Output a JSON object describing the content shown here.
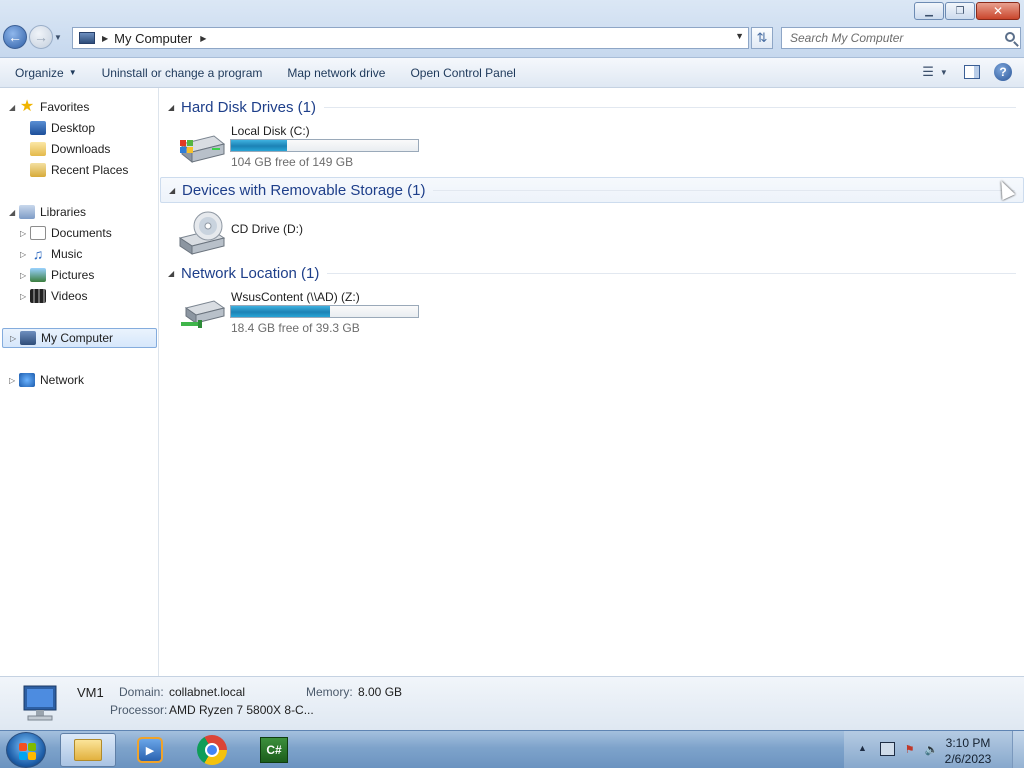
{
  "window": {
    "controls": {
      "minimize": "▁",
      "maximize": "❐",
      "close": "✕"
    }
  },
  "address": {
    "path": "My Computer",
    "search_placeholder": "Search My Computer"
  },
  "toolbar": {
    "organize": "Organize",
    "uninstall": "Uninstall or change a program",
    "map_drive": "Map network drive",
    "control_panel": "Open Control Panel"
  },
  "nav": {
    "favorites": "Favorites",
    "desktop": "Desktop",
    "downloads": "Downloads",
    "recent": "Recent Places",
    "libraries": "Libraries",
    "documents": "Documents",
    "music": "Music",
    "pictures": "Pictures",
    "videos": "Videos",
    "computer": "My Computer",
    "network": "Network"
  },
  "groups": {
    "hdd": "Hard Disk Drives (1)",
    "removable": "Devices with Removable Storage (1)",
    "network": "Network Location (1)"
  },
  "drives": {
    "c": {
      "name": "Local Disk (C:)",
      "free": "104 GB free of 149 GB",
      "used_fraction": 0.3
    },
    "d": {
      "name": "CD Drive (D:)"
    },
    "z": {
      "name": "WsusContent (\\\\AD) (Z:)",
      "free": "18.4 GB free of 39.3 GB",
      "used_fraction": 0.53
    }
  },
  "details": {
    "name": "VM1",
    "domain_label": "Domain:",
    "domain": "collabnet.local",
    "memory_label": "Memory:",
    "memory": "8.00 GB",
    "processor_label": "Processor:",
    "processor": "AMD Ryzen 7 5800X 8-C..."
  },
  "taskbar": {
    "csharp_label": "C#",
    "time": "3:10 PM",
    "date": "2/6/2023"
  },
  "colors": {
    "group_title": "#1e3f8a",
    "bar_fill": "#1c82b5"
  }
}
